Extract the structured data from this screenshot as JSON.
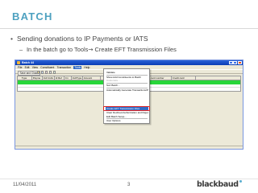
{
  "slide": {
    "title": "BATCH",
    "bullet_1": "Sending donations to IP Payments or IATS",
    "bullet_2_prefix": "In the batch go to Tools",
    "bullet_2_arrow": "→",
    "bullet_2_suffix": " Create EFT Transmission Files",
    "footer_date": "11/04/2011",
    "page_number": "3",
    "logo": "blackbaud"
  },
  "window": {
    "title": "Batch 44",
    "menus": [
      "File",
      "Edit",
      "View",
      "Constituent",
      "Transaction",
      "Tools",
      "Help"
    ],
    "open_menu_index": 5,
    "save_close_label": "Save and Close",
    "grid_columns": [
      "Type",
      "Payme",
      "Ind/ Indiv",
      "Id Ref",
      "Cn",
      "Ind/Type",
      "Amount",
      "",
      "",
      "BPFI",
      "Credit card number",
      "Credit card"
    ]
  },
  "tools_menu": {
    "items": [
      {
        "label": "Validate",
        "disabled": false
      },
      {
        "label": "Show Add Constituents to Batch",
        "disabled": false
      },
      {
        "label": "Customize...",
        "disabled": true
      },
      {
        "label": "Sort Batch...",
        "disabled": false
      },
      {
        "label": "Automatically Generate Transactions/Payments",
        "disabled": false
      },
      {
        "label": "Create EFT Transmission Files",
        "disabled": false
      },
      {
        "label": "Clear Declined Authorization and Rejection Codes",
        "disabled": false
      },
      {
        "label": "Edit Batch Setup...",
        "disabled": false
      },
      {
        "label": "User Options",
        "disabled": false
      }
    ],
    "active_index": 5
  },
  "colors": {
    "title": "#4ea1c0",
    "highlight_row": "#28d63a",
    "menu_selection": "#316ac5",
    "callout": "#e02424"
  }
}
